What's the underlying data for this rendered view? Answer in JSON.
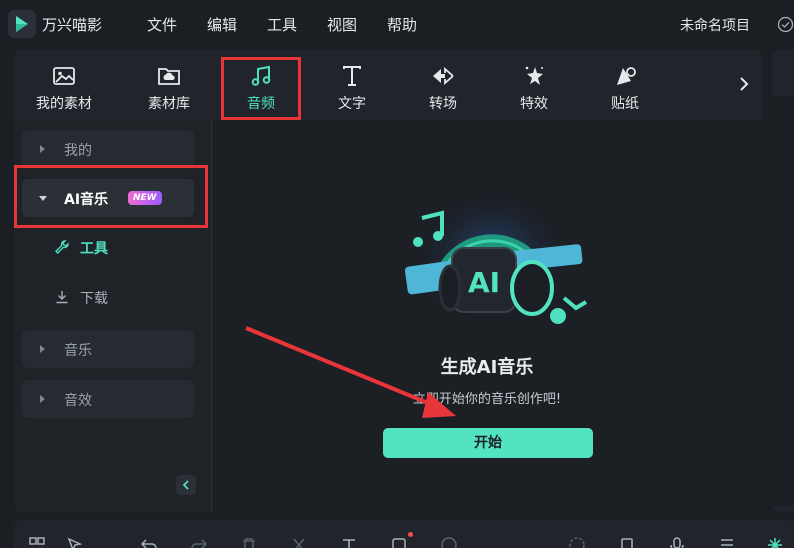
{
  "app": {
    "name": "万兴喵影",
    "project_name": "未命名项目"
  },
  "menu": [
    "文件",
    "编辑",
    "工具",
    "视图",
    "帮助"
  ],
  "tabs": [
    {
      "label": "我的素材",
      "icon": "image-icon"
    },
    {
      "label": "素材库",
      "icon": "cloud-folder-icon"
    },
    {
      "label": "音频",
      "icon": "music-note-icon",
      "active": true
    },
    {
      "label": "文字",
      "icon": "text-icon"
    },
    {
      "label": "转场",
      "icon": "transition-icon"
    },
    {
      "label": "特效",
      "icon": "effects-icon"
    },
    {
      "label": "贴纸",
      "icon": "sticker-icon"
    }
  ],
  "sidebar": {
    "mine": "我的",
    "ai_music": "AI音乐",
    "new_badge": "NEW",
    "tools": "工具",
    "download": "下载",
    "music": "音乐",
    "sfx": "音效"
  },
  "hero": {
    "title": "生成AI音乐",
    "subtitle": "立即开始你的音乐创作吧!",
    "start_button": "开始",
    "art_label": "AI"
  },
  "colors": {
    "accent": "#4fe0bf",
    "button": "#52e3c0",
    "annotation": "#e8353a"
  }
}
